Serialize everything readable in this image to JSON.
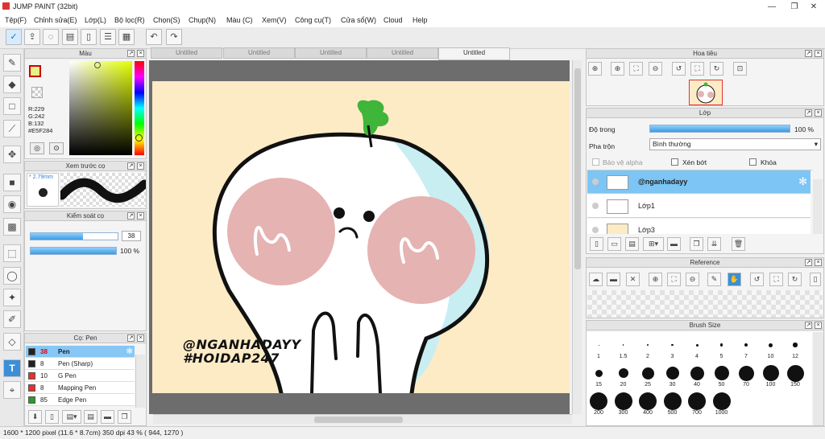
{
  "window": {
    "title": "JUMP PAINT (32bit)"
  },
  "menu": [
    "Tệp(F)",
    "Chỉnh sửa(E)",
    "Lớp(L)",
    "Bộ lọc(R)",
    "Chọn(S)",
    "Chụp(N)",
    "Màu (C)",
    "Xem(V)",
    "Công cụ(T)",
    "Cửa sổ(W)",
    "Cloud",
    "Help"
  ],
  "tabs": [
    "Untitled",
    "Untitled",
    "Untitled",
    "Untitled",
    "Untitled"
  ],
  "color_panel": {
    "title": "Màu",
    "r": "R:229",
    "g": "G:242",
    "b": "B:132",
    "hex": "#E5F284"
  },
  "brush_preview": {
    "title": "Xem trước cọ",
    "size": "2.79mm"
  },
  "brush_control": {
    "title": "Kiểm soát cọ",
    "size_value": "38",
    "size_fraction": 0.6,
    "opacity_value": "100 %",
    "opacity_fraction": 1.0
  },
  "brush_list": {
    "title": "Cọ: Pen",
    "items": [
      {
        "size": "38",
        "name": "Pen",
        "color": "#222222",
        "selected": true
      },
      {
        "size": "8",
        "name": "Pen (Sharp)",
        "color": "#222222"
      },
      {
        "size": "10",
        "name": "G Pen",
        "color": "#e83030"
      },
      {
        "size": "8",
        "name": "Mapping Pen",
        "color": "#e83030"
      },
      {
        "size": "85",
        "name": "Edge Pen",
        "color": "#2a9a2a"
      }
    ]
  },
  "canvas": {
    "watermark_1": "@NGANHADAYY",
    "watermark_2": "#HOIDAP247",
    "bg": "#fdebc6"
  },
  "navigator": {
    "title": "Hoa tiêu"
  },
  "layers": {
    "title": "Lớp",
    "opacity_label": "Độ trong",
    "opacity_value": "100 %",
    "opacity_fraction": 1.0,
    "blend_label": "Pha trộn",
    "blend_value": "Bình thường",
    "protect_alpha": "Bảo vệ alpha",
    "clipping": "Xén bớt",
    "lock": "Khóa",
    "items": [
      {
        "name": "@nganhadayy",
        "selected": true
      },
      {
        "name": "Lớp1"
      },
      {
        "name": "Lớp3"
      }
    ]
  },
  "reference": {
    "title": "Reference"
  },
  "brush_size": {
    "title": "Brush Size",
    "sizes": [
      "1",
      "1.5",
      "2",
      "3",
      "4",
      "5",
      "7",
      "10",
      "12",
      "15",
      "20",
      "25",
      "30",
      "40",
      "50",
      "70",
      "100",
      "150",
      "200",
      "300",
      "400",
      "500",
      "700",
      "1000"
    ]
  },
  "status": {
    "text": "1600 * 1200 pixel   (11.6 * 8.7cm)   350 dpi   43 %   ( 944, 1270 )"
  }
}
